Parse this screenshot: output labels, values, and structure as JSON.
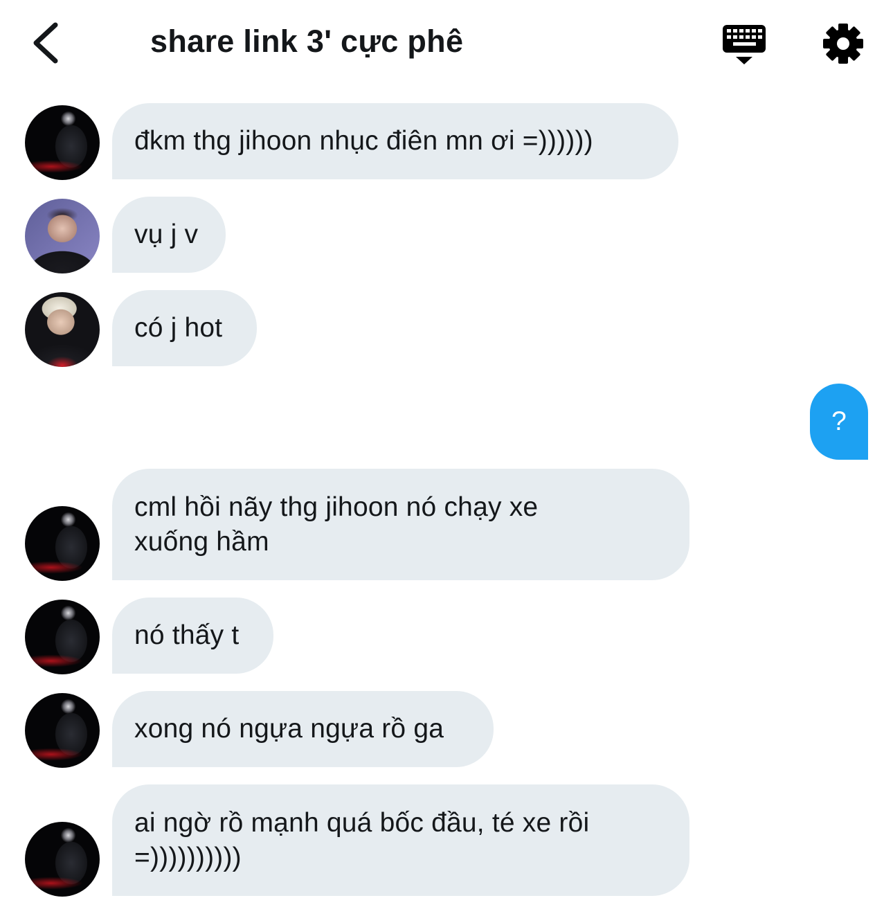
{
  "header": {
    "title": "share link 3' cực phê"
  },
  "messages": [
    {
      "side": "left",
      "avatar": "dark-photo",
      "text": "đkm thg jihoon nhục điên mn ơi =))))))"
    },
    {
      "side": "left",
      "avatar": "purple-photo",
      "text": "vụ j v"
    },
    {
      "side": "left",
      "avatar": "blond-photo",
      "text": "có j hot"
    },
    {
      "side": "right",
      "text": "?"
    },
    {
      "side": "left",
      "avatar": "dark-photo",
      "text": "cml hồi nãy thg jihoon nó chạy xe\nxuống hầm"
    },
    {
      "side": "left",
      "avatar": "dark-photo",
      "text": "nó thấy t"
    },
    {
      "side": "left",
      "avatar": "dark-photo",
      "text": "xong nó ngựa ngựa rồ ga"
    },
    {
      "side": "left",
      "avatar": "dark-photo",
      "text": "ai ngờ rồ mạnh quá bốc đầu, té xe rồi\n=))))))))))"
    }
  ],
  "colors": {
    "incoming_bubble": "#e6ecf0",
    "outgoing_bubble": "#1da1f2",
    "text": "#14171a"
  }
}
